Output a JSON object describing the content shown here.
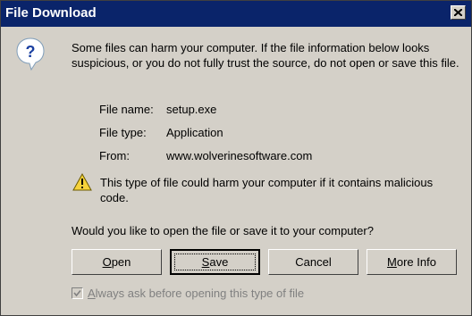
{
  "window": {
    "title": "File Download"
  },
  "icons": {
    "title_close": "close-icon",
    "dialog": "question-icon",
    "warning": "warning-icon"
  },
  "intro_text": "Some files can harm your computer. If the file information below looks suspicious, or you do not fully trust the source, do not open or save this file.",
  "file_info": {
    "name_label": "File name:",
    "name_value": "setup.exe",
    "type_label": "File type:",
    "type_value": "Application",
    "from_label": "From:",
    "from_value": "www.wolverinesoftware.com"
  },
  "warning_text": "This type of file could harm your computer if it contains malicious code.",
  "question": "Would you like to open the file or save it to your computer?",
  "buttons": {
    "open": {
      "first": "O",
      "rest": "pen"
    },
    "save": {
      "first": "S",
      "rest": "ave"
    },
    "cancel": "Cancel",
    "more_info": {
      "first": "M",
      "rest": "ore Info"
    }
  },
  "checkbox": {
    "first": "A",
    "rest": "lways ask before opening this type of file",
    "checked": true,
    "enabled": false
  }
}
